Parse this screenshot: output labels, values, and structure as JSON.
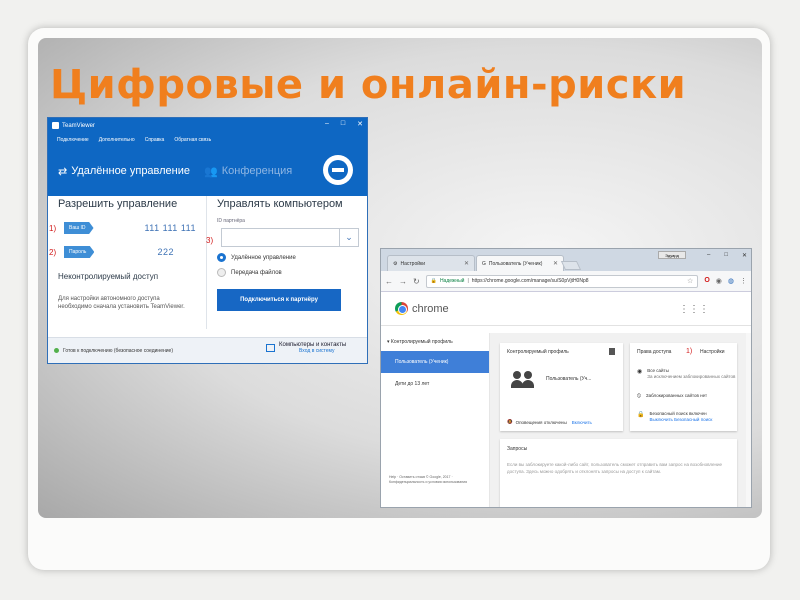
{
  "slide": {
    "title": "Цифровые и онлайн-риски"
  },
  "teamviewer": {
    "window_title": "TeamViewer",
    "window_controls": [
      "–",
      "□",
      "✕"
    ],
    "menu": [
      "Подключение",
      "Дополнительно",
      "Справка",
      "Обратная связь"
    ],
    "tabs": [
      {
        "icon": "arrows-icon",
        "label": "Удалённое управление"
      },
      {
        "icon": "people-icon",
        "label": "Конференция"
      }
    ],
    "allow": {
      "heading": "Разрешить управление",
      "id": {
        "number": "1)",
        "tag": "Ваш ID",
        "value": "111 111 111"
      },
      "password": {
        "number": "2)",
        "tag": "Пароль",
        "value": "222"
      },
      "unattended_heading": "Неконтролируемый доступ",
      "unattended_text": "Для настройки автономного доступа необходимо сначала установить TeamViewer."
    },
    "control": {
      "heading": "Управлять компьютером",
      "partner_label": "ID партнёра",
      "number": "3)",
      "partner_value": "",
      "radio_remote": "Удалённое управление",
      "radio_files": "Передача файлов",
      "connect": "Подключиться к партнёру"
    },
    "status": {
      "text": "Готов к подключению (безопасное соединение)",
      "contacts": "Компьютеры и контакты",
      "signin": "Вход в систему"
    }
  },
  "chrome": {
    "tabs": [
      "Настройки",
      "Пользователь (Ученик)"
    ],
    "user_button": "Эдуард",
    "secure": "Надежный",
    "url": "https://chrome.google.com/manage/su/S0pVjtH0Np8",
    "brand": "chrome",
    "sidebar": {
      "heading": "Контролируемый профиль",
      "items": [
        "Пользователь (Ученик)",
        "Дети до 13 лет"
      ],
      "footer": "Help · Оставить отзыв © Google, 2017 · Конфиденциальность и условия использования"
    },
    "profile_card": {
      "title": "Контролируемый профиль",
      "user": "Пользователь (Уч...",
      "notifications": "Оповещения отключены",
      "enable_link": "Включить"
    },
    "access_card": {
      "title": "Права доступа",
      "number": "1)",
      "settings": "Настройки",
      "items": [
        {
          "icon": "eye-icon",
          "title": "Все сайты",
          "sub": "За исключением заблокированных сайтов"
        },
        {
          "icon": "block-icon",
          "title": "Заблокированных сайтов нет",
          "sub": ""
        },
        {
          "icon": "lock-icon",
          "title": "Безопасный поиск включен",
          "sub": "Выключить Безопасный поиск"
        }
      ]
    },
    "requests_card": {
      "title": "Запросы",
      "text": "Если вы заблокируете какой-либо сайт, пользователь сможет отправить вам запрос на возобновление доступа. Здесь можно одобрять и отклонять запросы на доступ к сайтам."
    }
  }
}
